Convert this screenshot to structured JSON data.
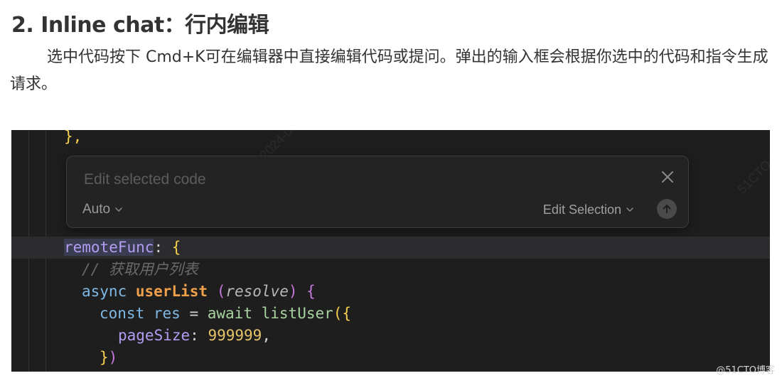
{
  "article": {
    "heading": "2. Inline chat：行内编辑",
    "paragraph": "选中代码按下 Cmd+K可在编辑器中直接编辑代码或提问。弹出的输入框会根据你选中的代码和指令生成请求。"
  },
  "screenshot": {
    "edit_box": {
      "input_placeholder": "Edit selected code",
      "mode_label": "Auto",
      "action_label": "Edit Selection"
    },
    "code": {
      "line_top": "},",
      "line_prop": "remoteFunc",
      "line_comment": "// 获取用户列表",
      "kw_async": "async",
      "fn_name": "userList",
      "param_name": "resolve",
      "kw_const": "const",
      "var_res": "res",
      "kw_await": "await",
      "call_name": "listUser",
      "prop_page": "pageSize",
      "num_value": "999999"
    }
  },
  "credit": "@51CTO博客"
}
